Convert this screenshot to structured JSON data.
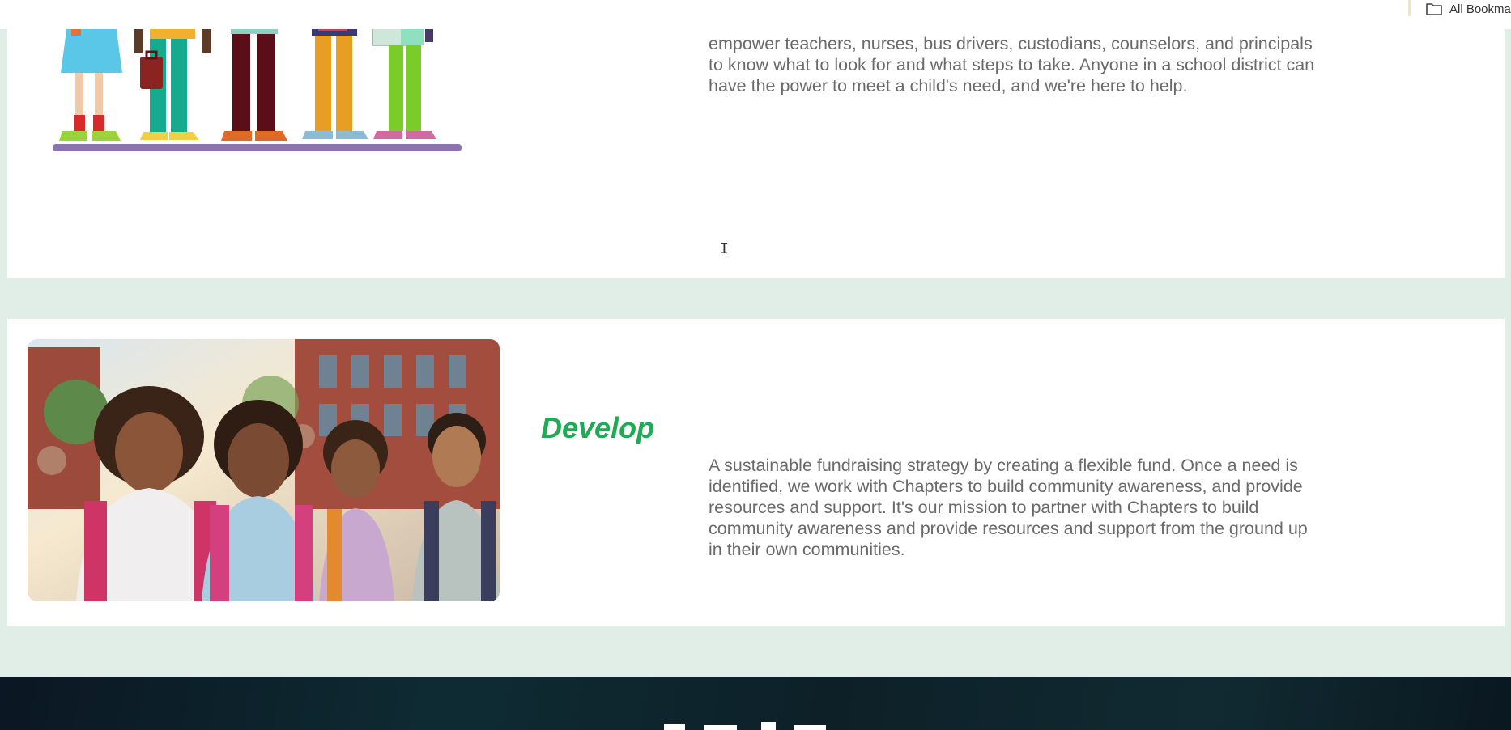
{
  "browser": {
    "bookmarks": {
      "folder_label": "All Bookma",
      "folder_icon": "folder-icon"
    }
  },
  "sections": {
    "empower": {
      "text": "empower teachers, nurses, bus drivers, custodians, counselors, and principals to know what to look for and what steps to take. Anyone in a school district can have the power to meet a child's need, and we're here to help."
    },
    "develop": {
      "title": "Develop",
      "text": "A sustainable fundraising strategy by creating a flexible fund. Once a need is identified, we work with Chapters to build community awareness, and provide resources and support. It's our mission to partner with Chapters to build community awareness and provide resources and support from the ground up in their own communities."
    }
  },
  "colors": {
    "page_background": "#e1ede7",
    "accent_green": "#1faa55",
    "body_text": "#6a6a6a",
    "footer_dark": "#0d2028"
  },
  "cursor": {
    "icon": "text-cursor-icon"
  }
}
